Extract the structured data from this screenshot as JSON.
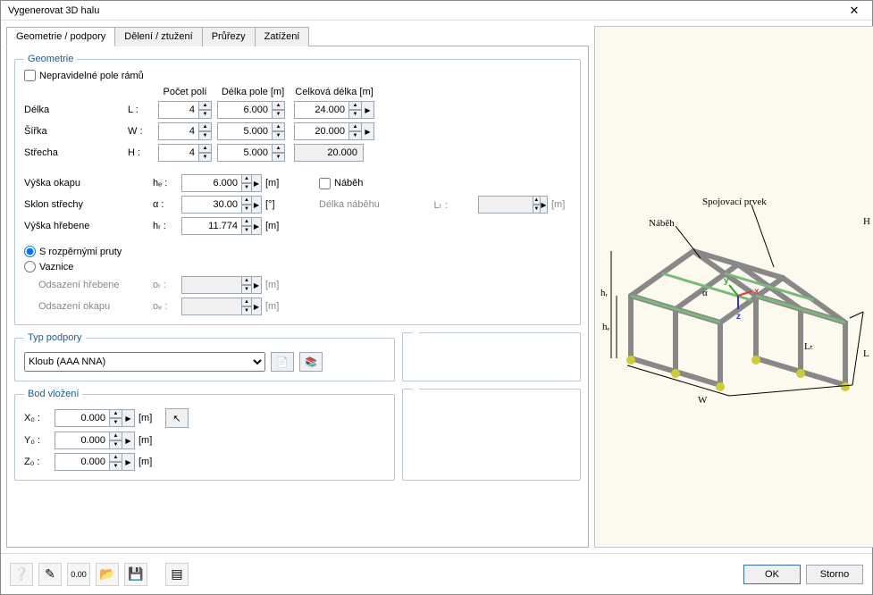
{
  "window_title": "Vygenerovat 3D halu",
  "tabs": [
    "Geometrie / podpory",
    "Dělení / ztužení",
    "Průřezy",
    "Zatížení"
  ],
  "active_tab": 0,
  "geom": {
    "legend": "Geometrie",
    "irregular_label": "Nepravidelné pole rámů",
    "irregular_checked": false,
    "hdr_count": "Počet polí",
    "hdr_span": "Délka pole [m]",
    "hdr_total": "Celková délka [m]",
    "rows": [
      {
        "label": "Délka",
        "sym": "L :",
        "count": "4",
        "span": "6.000",
        "total": "24.000",
        "total_editable": true
      },
      {
        "label": "Šířka",
        "sym": "W :",
        "count": "4",
        "span": "5.000",
        "total": "20.000",
        "total_editable": true
      },
      {
        "label": "Střecha",
        "sym": "H :",
        "count": "4",
        "span": "5.000",
        "total": "20.000",
        "total_editable": false
      }
    ],
    "eave_label": "Výška okapu",
    "eave_sym": "hₑ :",
    "eave_val": "6.000",
    "eave_unit": "[m]",
    "slope_label": "Sklon střechy",
    "slope_sym": "α :",
    "slope_val": "30.00",
    "slope_unit": "[°]",
    "ridge_label": "Výška hřebene",
    "ridge_sym": "hᵣ :",
    "ridge_val": "11.774",
    "ridge_unit": "[m]",
    "haunch_label": "Náběh",
    "haunch_checked": false,
    "haunch_len_label": "Délka náběhu",
    "haunch_len_sym": "Lₜ :",
    "haunch_len_val": "",
    "haunch_len_unit": "[m]",
    "radio_struts": "S rozpěrnými pruty",
    "radio_purlins": "Vaznice",
    "radio_sel": "struts",
    "off_ridge_label": "Odsazení hřebene",
    "off_ridge_sym": "oᵣ :",
    "off_ridge_unit": "[m]",
    "off_eave_label": "Odsazení okapu",
    "off_eave_sym": "oₑ :",
    "off_eave_unit": "[m]"
  },
  "support": {
    "legend": "Typ podpory",
    "selected": "Kloub (AAA NNA)"
  },
  "insert": {
    "legend": "Bod vložení",
    "x_label": "X₀ :",
    "x_val": "0.000",
    "x_unit": "[m]",
    "y_label": "Y₀ :",
    "y_val": "0.000",
    "y_unit": "[m]",
    "z_label": "Z₀ :",
    "z_val": "0.000",
    "z_unit": "[m]"
  },
  "preview": {
    "label_conn": "Spojovací prvek",
    "label_haunch": "Náběh",
    "sym_H": "H",
    "sym_L": "L",
    "sym_W": "W",
    "sym_hr": "hᵣ",
    "sym_he": "hₑ",
    "sym_Lt": "Lₜ",
    "sym_a": "α",
    "sym_x": "x",
    "sym_y": "y",
    "sym_z": "z"
  },
  "footer": {
    "ok": "OK",
    "cancel": "Storno"
  }
}
